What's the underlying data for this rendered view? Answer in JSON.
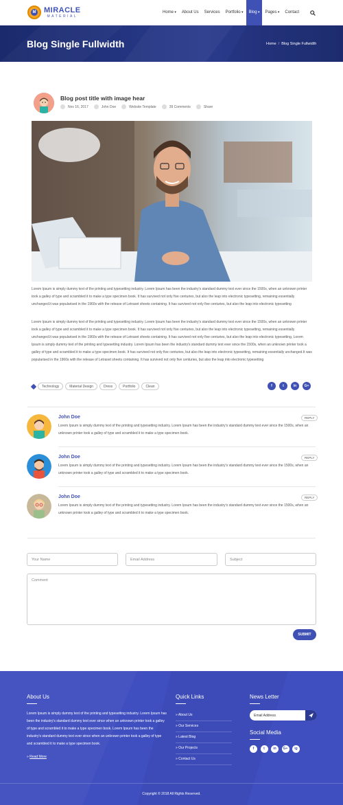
{
  "brand": {
    "name": "MIRACLE",
    "tagline": "MATERIAL"
  },
  "nav": [
    "Home",
    "About Us",
    "Services",
    "Portfolio",
    "Blog",
    "Pages",
    "Contact"
  ],
  "nav_dropdown": [
    true,
    false,
    false,
    true,
    true,
    true,
    false
  ],
  "nav_active_index": 4,
  "banner": {
    "title": "Blog Single Fullwidth",
    "breadcrumb_home": "Home",
    "breadcrumb_sep": "/",
    "breadcrumb_current": "Blog Single Fullwidth"
  },
  "post": {
    "title": "Blog post title with image hear",
    "date": "Nov 16, 2017",
    "author": "John Doe",
    "category": "Website Template",
    "comments": "39 Comments",
    "share": "Share",
    "para1": "Lorem Ipsum is simply dummy text of the printing and typesetting industry. Lorem Ipsum has been the industry's standard dummy text ever since the 1500s, when an unknown printer took a galley of type and scrambled it to make a type specimen book. It has survived not only five centuries, but also the leap into electronic typesetting, remaining essentially unchanged.It was popularised in the 1960s with the release of Letraset sheets containing. It has survived not only five centuries, but also the leap into electronic typesetting",
    "para2": "Lorem Ipsum is simply dummy text of the printing and typesetting industry. Lorem Ipsum has been the industry's standard dummy text ever since the 1500s, when an unknown printer took a galley of type and scrambled it to make a type specimen book. It has survived not only five centuries, but also the leap into electronic typesetting, remaining essentially unchanged.It was popularised in the 1960s with the release of Letraset sheets containing. It has survived not only five centuries, but also the leap into electronic typesetting, Lorem Ipsum is simply dummy text of the printing and typesetting industry. Lorem Ipsum has been the industry's standard dummy text ever since the 1500s, when an unknown printer took a galley of type and scrambled it to make a type specimen book. It has survived not only five centuries, but also the leap into electronic typesetting, remaining essentially unchanged.It was popularised in the 1960s with the release of Letraset sheets containing. It has survived not only five centuries, but also the leap into electronic typesetting",
    "tags": [
      "Technology",
      "Material Design",
      "Dress",
      "Portfolio",
      "Clean"
    ],
    "share_icons": [
      "f",
      "t",
      "in",
      "G+"
    ]
  },
  "comments": [
    {
      "name": "John Doe",
      "reply": "REPLY",
      "text": "Lorem Ipsum is simply dummy text of the printing and typesetting industry. Lorem Ipsum has been the industry's standard dummy text ever since the 1500s, when an unknown printer took a galley of type and scrambled it to make a type specimen book."
    },
    {
      "name": "John Doe",
      "reply": "REPLY",
      "text": "Lorem Ipsum is simply dummy text of the printing and typesetting industry. Lorem Ipsum has been the industry's standard dummy text ever since the 1500s, when an unknown printer took a galley of type and scrambled it to make a type specimen book."
    },
    {
      "name": "John Doe",
      "reply": "REPLY",
      "text": "Lorem Ipsum is simply dummy text of the printing and typesetting industry. Lorem Ipsum has been the industry's standard dummy text ever since the 1500s, when an unknown printer took a galley of type and scrambled it to make a type specimen book."
    }
  ],
  "form": {
    "name_placeholder": "Your Name",
    "email_placeholder": "Email Address",
    "subject_placeholder": "Subject",
    "comment_placeholder": "Comment",
    "submit": "SUBMIT"
  },
  "footer": {
    "about_title": "About Us",
    "about_text": "Lorem Ipsum is simply dummy text of the printing and typesetting industry. Lorem Ipsum has been the industry's standard dummy text ever since when an unknown printer took a galley of type and scrambled it to make a type specimen book. Lorem Ipsum has been the industry's standard dummy text ever since when an unknown printer took a galley of type and scrambled it to make a type specimen book.",
    "read_more": "Read More",
    "links_title": "Quick Links",
    "links": [
      "About Us",
      "Our Services",
      "Latest Blog",
      "Our Projects",
      "Contact Us"
    ],
    "newsletter_title": "News Letter",
    "newsletter_placeholder": "Email Address",
    "social_title": "Social Media",
    "social": [
      "f",
      "t",
      "in",
      "G+",
      "ig"
    ],
    "copyright": "Copyright © 2018 All Rights Reserved."
  },
  "colors": {
    "accent": "#3f51b5",
    "banner": "#1a2a6c",
    "footer": "#3f4fbf"
  }
}
